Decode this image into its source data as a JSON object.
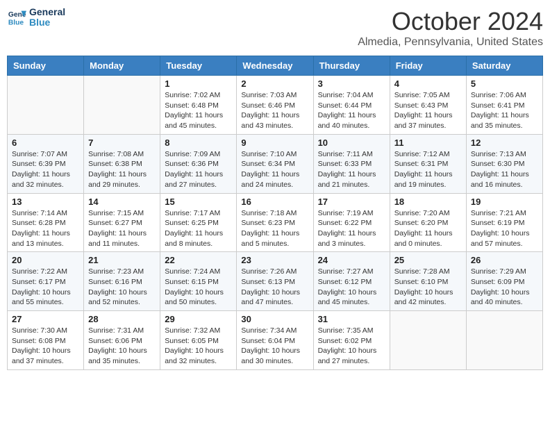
{
  "header": {
    "logo_line1": "General",
    "logo_line2": "Blue",
    "month": "October 2024",
    "location": "Almedia, Pennsylvania, United States"
  },
  "days_of_week": [
    "Sunday",
    "Monday",
    "Tuesday",
    "Wednesday",
    "Thursday",
    "Friday",
    "Saturday"
  ],
  "weeks": [
    [
      {
        "date": "",
        "info": ""
      },
      {
        "date": "",
        "info": ""
      },
      {
        "date": "1",
        "sunrise": "7:02 AM",
        "sunset": "6:48 PM",
        "daylight": "11 hours and 45 minutes."
      },
      {
        "date": "2",
        "sunrise": "7:03 AM",
        "sunset": "6:46 PM",
        "daylight": "11 hours and 43 minutes."
      },
      {
        "date": "3",
        "sunrise": "7:04 AM",
        "sunset": "6:44 PM",
        "daylight": "11 hours and 40 minutes."
      },
      {
        "date": "4",
        "sunrise": "7:05 AM",
        "sunset": "6:43 PM",
        "daylight": "11 hours and 37 minutes."
      },
      {
        "date": "5",
        "sunrise": "7:06 AM",
        "sunset": "6:41 PM",
        "daylight": "11 hours and 35 minutes."
      }
    ],
    [
      {
        "date": "6",
        "sunrise": "7:07 AM",
        "sunset": "6:39 PM",
        "daylight": "11 hours and 32 minutes."
      },
      {
        "date": "7",
        "sunrise": "7:08 AM",
        "sunset": "6:38 PM",
        "daylight": "11 hours and 29 minutes."
      },
      {
        "date": "8",
        "sunrise": "7:09 AM",
        "sunset": "6:36 PM",
        "daylight": "11 hours and 27 minutes."
      },
      {
        "date": "9",
        "sunrise": "7:10 AM",
        "sunset": "6:34 PM",
        "daylight": "11 hours and 24 minutes."
      },
      {
        "date": "10",
        "sunrise": "7:11 AM",
        "sunset": "6:33 PM",
        "daylight": "11 hours and 21 minutes."
      },
      {
        "date": "11",
        "sunrise": "7:12 AM",
        "sunset": "6:31 PM",
        "daylight": "11 hours and 19 minutes."
      },
      {
        "date": "12",
        "sunrise": "7:13 AM",
        "sunset": "6:30 PM",
        "daylight": "11 hours and 16 minutes."
      }
    ],
    [
      {
        "date": "13",
        "sunrise": "7:14 AM",
        "sunset": "6:28 PM",
        "daylight": "11 hours and 13 minutes."
      },
      {
        "date": "14",
        "sunrise": "7:15 AM",
        "sunset": "6:27 PM",
        "daylight": "11 hours and 11 minutes."
      },
      {
        "date": "15",
        "sunrise": "7:17 AM",
        "sunset": "6:25 PM",
        "daylight": "11 hours and 8 minutes."
      },
      {
        "date": "16",
        "sunrise": "7:18 AM",
        "sunset": "6:23 PM",
        "daylight": "11 hours and 5 minutes."
      },
      {
        "date": "17",
        "sunrise": "7:19 AM",
        "sunset": "6:22 PM",
        "daylight": "11 hours and 3 minutes."
      },
      {
        "date": "18",
        "sunrise": "7:20 AM",
        "sunset": "6:20 PM",
        "daylight": "11 hours and 0 minutes."
      },
      {
        "date": "19",
        "sunrise": "7:21 AM",
        "sunset": "6:19 PM",
        "daylight": "10 hours and 57 minutes."
      }
    ],
    [
      {
        "date": "20",
        "sunrise": "7:22 AM",
        "sunset": "6:17 PM",
        "daylight": "10 hours and 55 minutes."
      },
      {
        "date": "21",
        "sunrise": "7:23 AM",
        "sunset": "6:16 PM",
        "daylight": "10 hours and 52 minutes."
      },
      {
        "date": "22",
        "sunrise": "7:24 AM",
        "sunset": "6:15 PM",
        "daylight": "10 hours and 50 minutes."
      },
      {
        "date": "23",
        "sunrise": "7:26 AM",
        "sunset": "6:13 PM",
        "daylight": "10 hours and 47 minutes."
      },
      {
        "date": "24",
        "sunrise": "7:27 AM",
        "sunset": "6:12 PM",
        "daylight": "10 hours and 45 minutes."
      },
      {
        "date": "25",
        "sunrise": "7:28 AM",
        "sunset": "6:10 PM",
        "daylight": "10 hours and 42 minutes."
      },
      {
        "date": "26",
        "sunrise": "7:29 AM",
        "sunset": "6:09 PM",
        "daylight": "10 hours and 40 minutes."
      }
    ],
    [
      {
        "date": "27",
        "sunrise": "7:30 AM",
        "sunset": "6:08 PM",
        "daylight": "10 hours and 37 minutes."
      },
      {
        "date": "28",
        "sunrise": "7:31 AM",
        "sunset": "6:06 PM",
        "daylight": "10 hours and 35 minutes."
      },
      {
        "date": "29",
        "sunrise": "7:32 AM",
        "sunset": "6:05 PM",
        "daylight": "10 hours and 32 minutes."
      },
      {
        "date": "30",
        "sunrise": "7:34 AM",
        "sunset": "6:04 PM",
        "daylight": "10 hours and 30 minutes."
      },
      {
        "date": "31",
        "sunrise": "7:35 AM",
        "sunset": "6:02 PM",
        "daylight": "10 hours and 27 minutes."
      },
      {
        "date": "",
        "info": ""
      },
      {
        "date": "",
        "info": ""
      }
    ]
  ],
  "labels": {
    "sunrise": "Sunrise:",
    "sunset": "Sunset:",
    "daylight": "Daylight:"
  }
}
